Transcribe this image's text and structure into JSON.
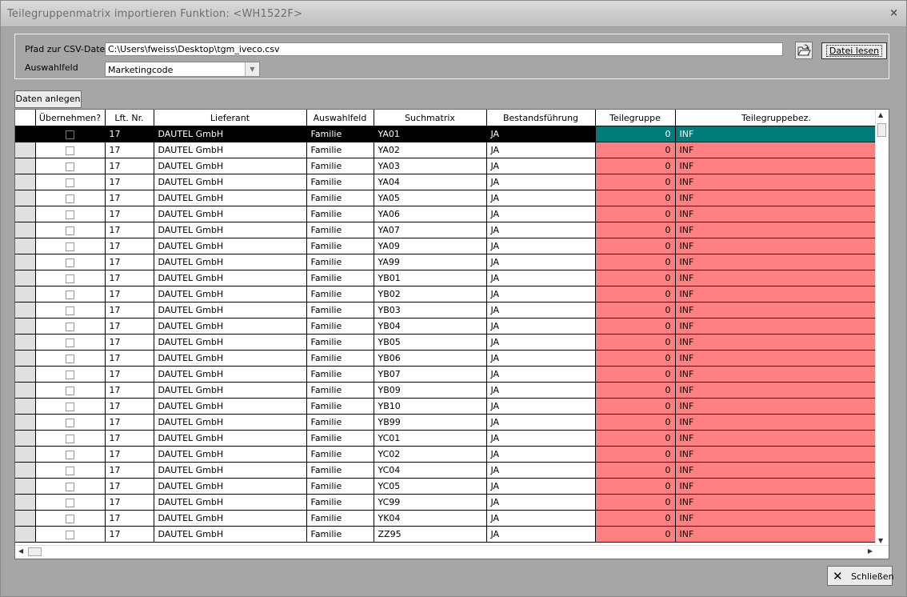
{
  "window": {
    "title": "Teilegruppenmatrix importieren Funktion: <WH1522F>",
    "close_glyph": "×"
  },
  "file": {
    "path_label": "Pfad zur CSV-Datei",
    "path_value": "C:\\Users\\fweiss\\Desktop\\tgm_iveco.csv",
    "select_label": "Auswahlfeld",
    "select_value": "Marketingcode",
    "read_button": "Datei lesen",
    "folder_icon": "folder-open-icon"
  },
  "toolbar": {
    "create_button": "Daten anlegen"
  },
  "grid": {
    "columns": [
      "Übernehmen?",
      "Lft. Nr.",
      "Lieferant",
      "Auswahlfeld",
      "Suchmatrix",
      "Bestandsführung",
      "Teilegruppe",
      "Teilegruppebez."
    ],
    "rows": [
      {
        "lft": "17",
        "lieferant": "DAUTEL GmbH",
        "feld": "Familie",
        "such": "YA01",
        "bestand": "JA",
        "tg": "0",
        "tgbez": "INF"
      },
      {
        "lft": "17",
        "lieferant": "DAUTEL GmbH",
        "feld": "Familie",
        "such": "YA02",
        "bestand": "JA",
        "tg": "0",
        "tgbez": "INF"
      },
      {
        "lft": "17",
        "lieferant": "DAUTEL GmbH",
        "feld": "Familie",
        "such": "YA03",
        "bestand": "JA",
        "tg": "0",
        "tgbez": "INF"
      },
      {
        "lft": "17",
        "lieferant": "DAUTEL GmbH",
        "feld": "Familie",
        "such": "YA04",
        "bestand": "JA",
        "tg": "0",
        "tgbez": "INF"
      },
      {
        "lft": "17",
        "lieferant": "DAUTEL GmbH",
        "feld": "Familie",
        "such": "YA05",
        "bestand": "JA",
        "tg": "0",
        "tgbez": "INF"
      },
      {
        "lft": "17",
        "lieferant": "DAUTEL GmbH",
        "feld": "Familie",
        "such": "YA06",
        "bestand": "JA",
        "tg": "0",
        "tgbez": "INF"
      },
      {
        "lft": "17",
        "lieferant": "DAUTEL GmbH",
        "feld": "Familie",
        "such": "YA07",
        "bestand": "JA",
        "tg": "0",
        "tgbez": "INF"
      },
      {
        "lft": "17",
        "lieferant": "DAUTEL GmbH",
        "feld": "Familie",
        "such": "YA09",
        "bestand": "JA",
        "tg": "0",
        "tgbez": "INF"
      },
      {
        "lft": "17",
        "lieferant": "DAUTEL GmbH",
        "feld": "Familie",
        "such": "YA99",
        "bestand": "JA",
        "tg": "0",
        "tgbez": "INF"
      },
      {
        "lft": "17",
        "lieferant": "DAUTEL GmbH",
        "feld": "Familie",
        "such": "YB01",
        "bestand": "JA",
        "tg": "0",
        "tgbez": "INF"
      },
      {
        "lft": "17",
        "lieferant": "DAUTEL GmbH",
        "feld": "Familie",
        "such": "YB02",
        "bestand": "JA",
        "tg": "0",
        "tgbez": "INF"
      },
      {
        "lft": "17",
        "lieferant": "DAUTEL GmbH",
        "feld": "Familie",
        "such": "YB03",
        "bestand": "JA",
        "tg": "0",
        "tgbez": "INF"
      },
      {
        "lft": "17",
        "lieferant": "DAUTEL GmbH",
        "feld": "Familie",
        "such": "YB04",
        "bestand": "JA",
        "tg": "0",
        "tgbez": "INF"
      },
      {
        "lft": "17",
        "lieferant": "DAUTEL GmbH",
        "feld": "Familie",
        "such": "YB05",
        "bestand": "JA",
        "tg": "0",
        "tgbez": "INF"
      },
      {
        "lft": "17",
        "lieferant": "DAUTEL GmbH",
        "feld": "Familie",
        "such": "YB06",
        "bestand": "JA",
        "tg": "0",
        "tgbez": "INF"
      },
      {
        "lft": "17",
        "lieferant": "DAUTEL GmbH",
        "feld": "Familie",
        "such": "YB07",
        "bestand": "JA",
        "tg": "0",
        "tgbez": "INF"
      },
      {
        "lft": "17",
        "lieferant": "DAUTEL GmbH",
        "feld": "Familie",
        "such": "YB09",
        "bestand": "JA",
        "tg": "0",
        "tgbez": "INF"
      },
      {
        "lft": "17",
        "lieferant": "DAUTEL GmbH",
        "feld": "Familie",
        "such": "YB10",
        "bestand": "JA",
        "tg": "0",
        "tgbez": "INF"
      },
      {
        "lft": "17",
        "lieferant": "DAUTEL GmbH",
        "feld": "Familie",
        "such": "YB99",
        "bestand": "JA",
        "tg": "0",
        "tgbez": "INF"
      },
      {
        "lft": "17",
        "lieferant": "DAUTEL GmbH",
        "feld": "Familie",
        "such": "YC01",
        "bestand": "JA",
        "tg": "0",
        "tgbez": "INF"
      },
      {
        "lft": "17",
        "lieferant": "DAUTEL GmbH",
        "feld": "Familie",
        "such": "YC02",
        "bestand": "JA",
        "tg": "0",
        "tgbez": "INF"
      },
      {
        "lft": "17",
        "lieferant": "DAUTEL GmbH",
        "feld": "Familie",
        "such": "YC04",
        "bestand": "JA",
        "tg": "0",
        "tgbez": "INF"
      },
      {
        "lft": "17",
        "lieferant": "DAUTEL GmbH",
        "feld": "Familie",
        "such": "YC05",
        "bestand": "JA",
        "tg": "0",
        "tgbez": "INF"
      },
      {
        "lft": "17",
        "lieferant": "DAUTEL GmbH",
        "feld": "Familie",
        "such": "YC99",
        "bestand": "JA",
        "tg": "0",
        "tgbez": "INF"
      },
      {
        "lft": "17",
        "lieferant": "DAUTEL GmbH",
        "feld": "Familie",
        "such": "YK04",
        "bestand": "JA",
        "tg": "0",
        "tgbez": "INF"
      },
      {
        "lft": "17",
        "lieferant": "DAUTEL GmbH",
        "feld": "Familie",
        "such": "ZZ95",
        "bestand": "JA",
        "tg": "0",
        "tgbez": "INF"
      }
    ],
    "colors": {
      "active_row": "#000000",
      "active_highlight": "#007b7b",
      "warning_cell": "#ff8080"
    }
  },
  "footer": {
    "close_button": "Schließen",
    "close_icon": "close-x-icon"
  }
}
